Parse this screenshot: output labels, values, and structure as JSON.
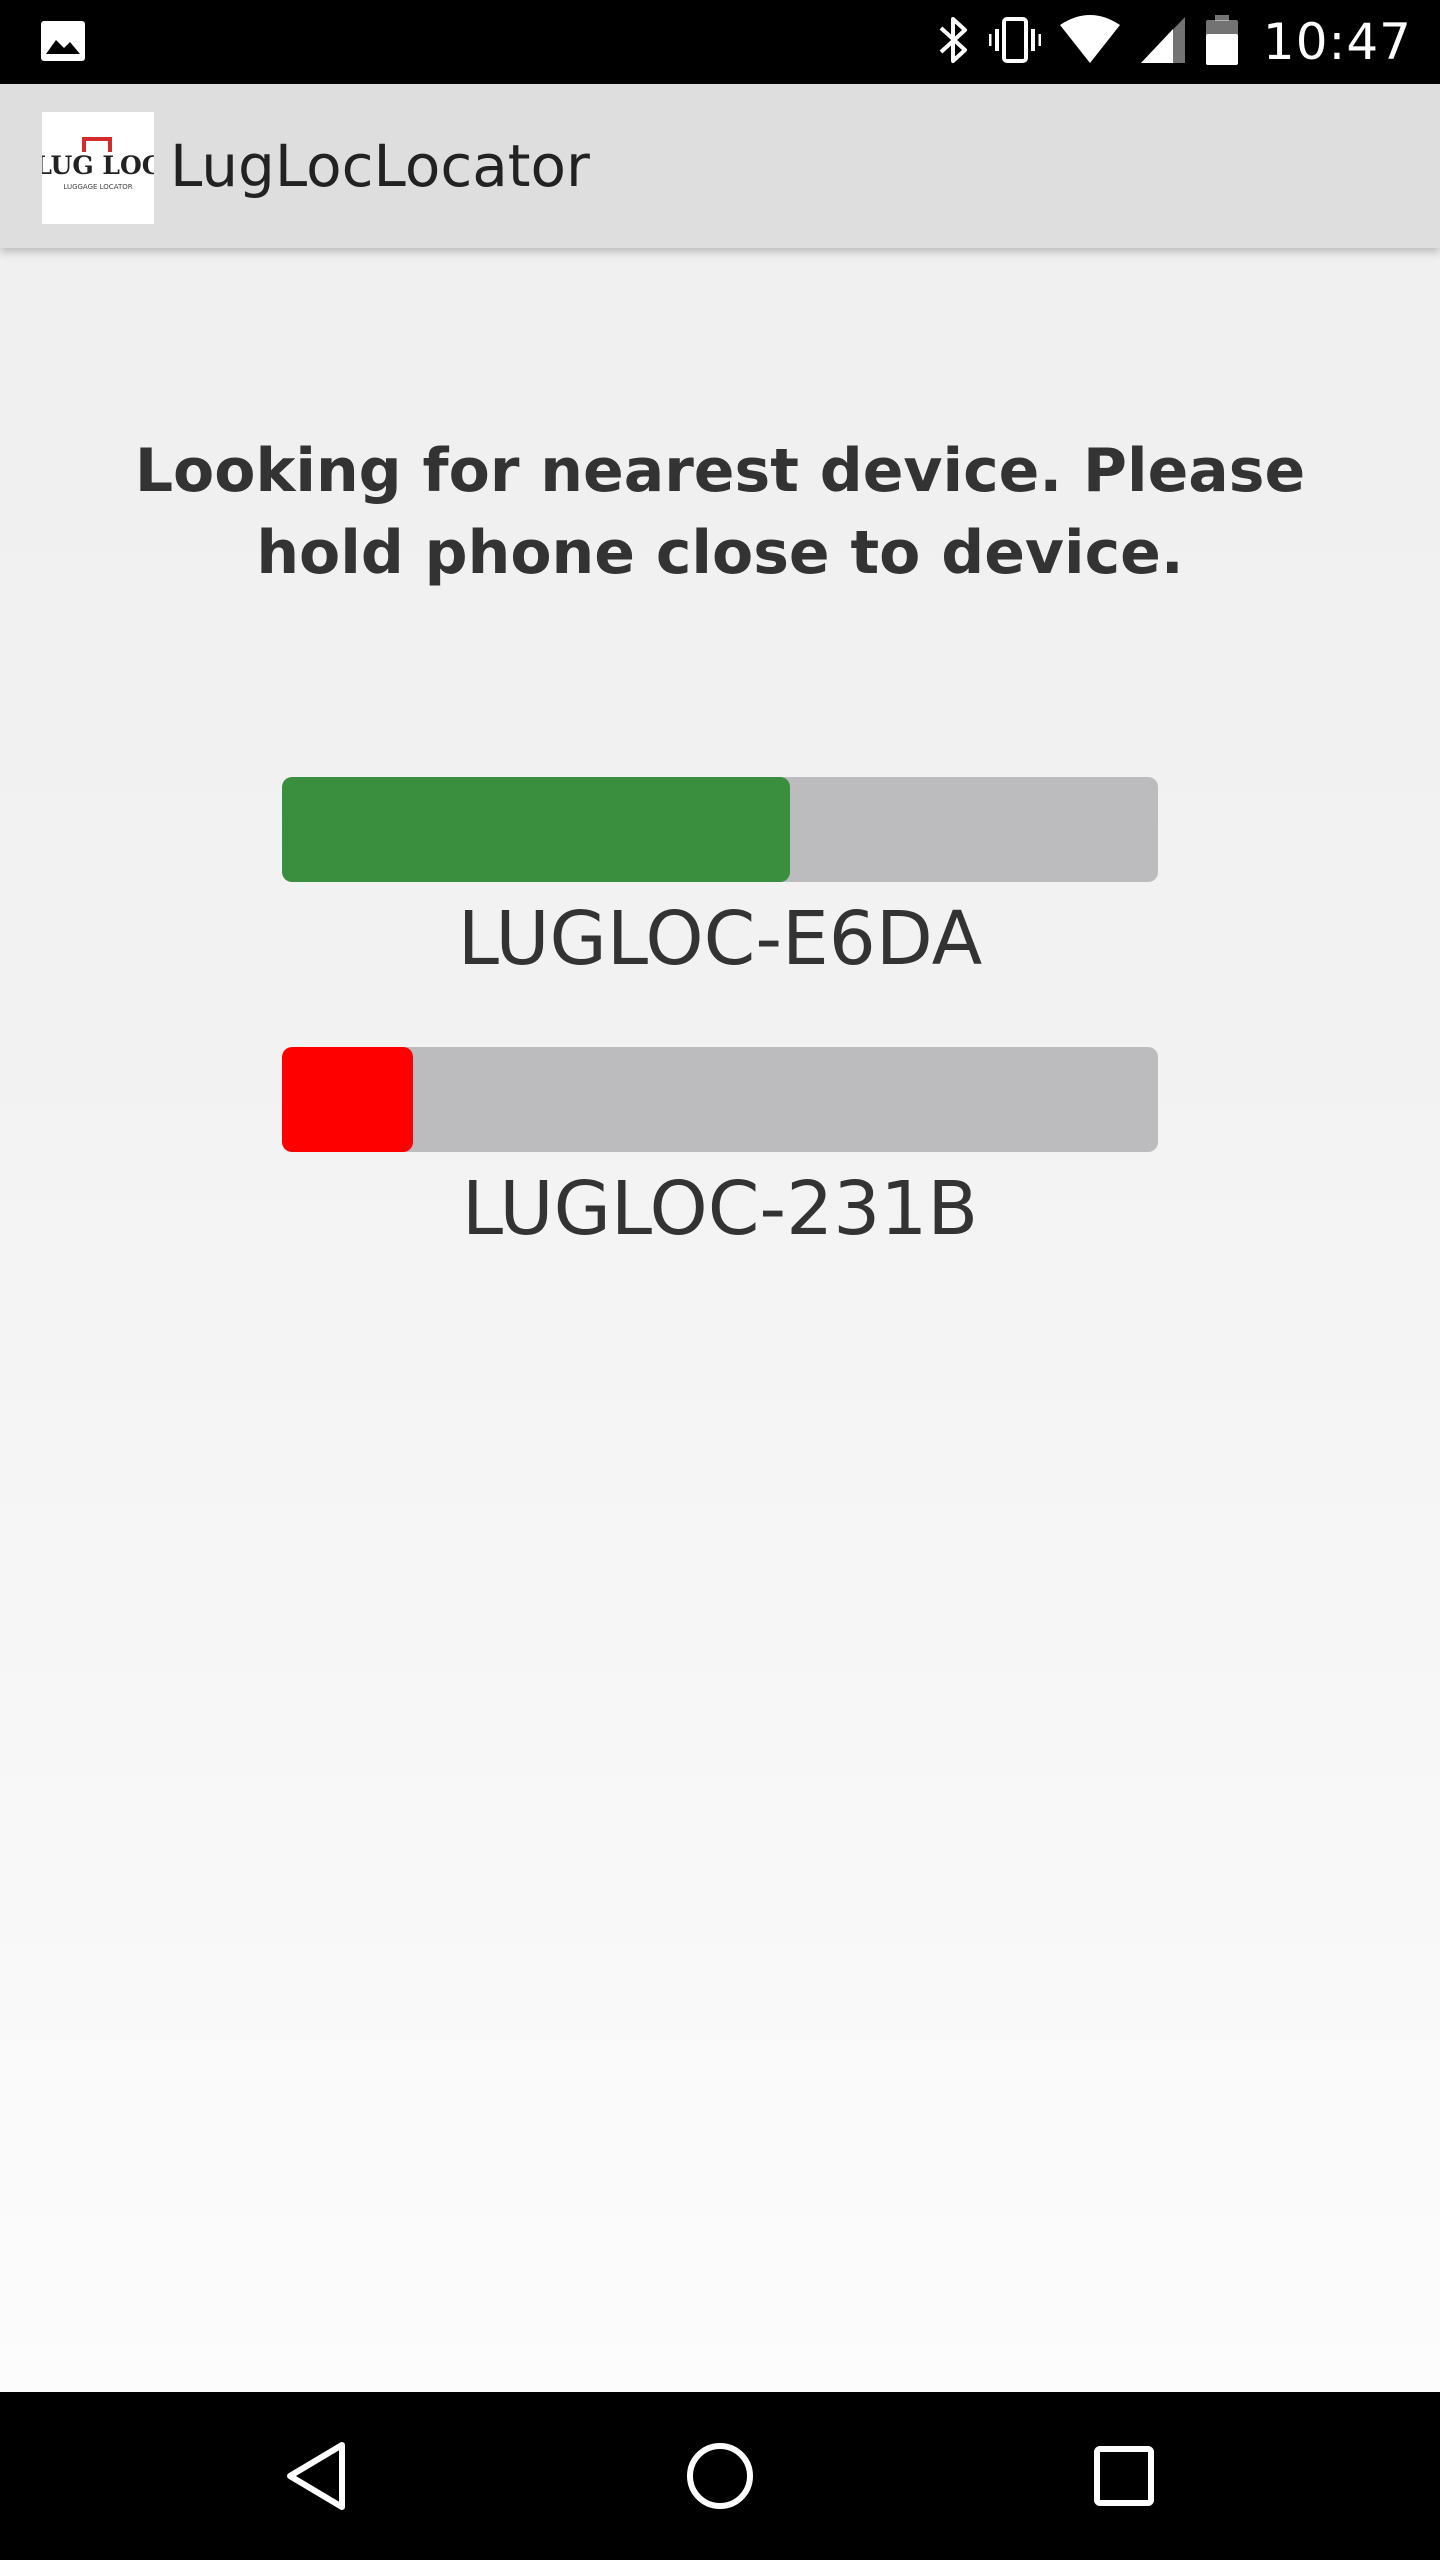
{
  "status_bar": {
    "time": "10:47",
    "icons": [
      "image-notification-icon",
      "bluetooth-icon",
      "vibrate-icon",
      "wifi-icon",
      "cellular-signal-icon",
      "battery-icon"
    ]
  },
  "app_bar": {
    "title": "LugLocLocator",
    "logo_text": "LUG LOC",
    "logo_subtext": "LUGGAGE LOCATOR"
  },
  "main": {
    "instructions": "Looking for nearest device. Please hold phone close to device.",
    "devices": [
      {
        "label": "LUGLOC-E6DA",
        "signal_fraction": 0.58,
        "color": "#3a8f3f"
      },
      {
        "label": "LUGLOC-231B",
        "signal_fraction": 0.15,
        "color": "#ff0000"
      }
    ]
  },
  "colors": {
    "status_bar_bg": "#000000",
    "app_bar_bg": "#dedede",
    "bar_track": "#bcbcbe",
    "text_primary": "#333333"
  },
  "nav_bar": {
    "icons": [
      "back-icon",
      "home-icon",
      "recents-icon"
    ]
  }
}
